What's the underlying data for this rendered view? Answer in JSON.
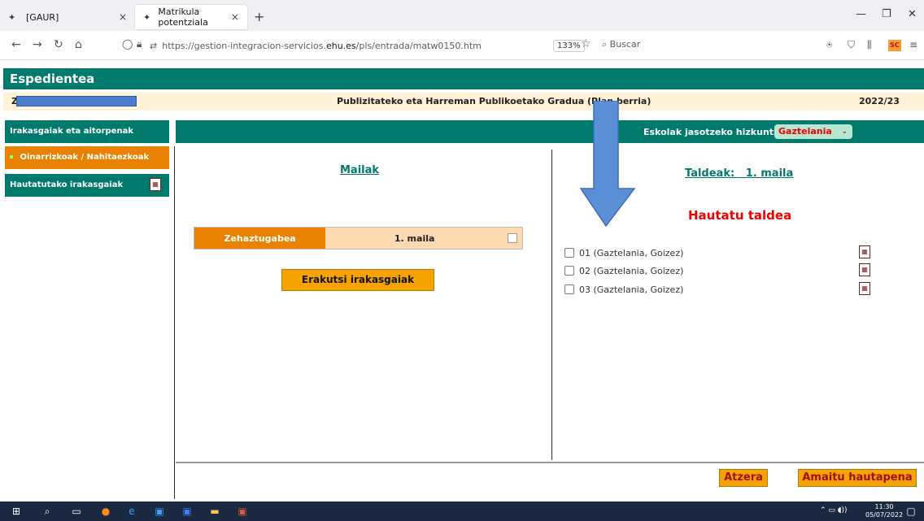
{
  "browser": {
    "tabs": [
      {
        "title": "[GAUR]",
        "close": "×"
      },
      {
        "title": "Matrikula potentziala",
        "close": "×"
      }
    ],
    "new_tab": "+",
    "url_prefix": "https://gestion-integracion-servicios.",
    "url_domain": "ehu.es",
    "url_suffix": "/pls/entrada/matw0150.htm",
    "zoom": "133%",
    "search_placeholder": "Buscar",
    "addon_label": "SC"
  },
  "header": {
    "title": "Espedientea"
  },
  "info": {
    "initial": "Z",
    "plan": "Publizitateko eta Harreman Publikoetako Gradua (Plan berria)",
    "year": "2022/23"
  },
  "sidebar": {
    "items": [
      {
        "label": "Irakasgaiak eta aitorpenak"
      },
      {
        "label": "Oinarrizkoak / Nahitaezkoak"
      },
      {
        "label": "Hautatutako irakasgaiak"
      }
    ]
  },
  "language": {
    "label": "Eskolak jasotzeko hizkuntza:",
    "selected": "Gaztelania"
  },
  "levels": {
    "title": "Mailak",
    "status": "Zehaztugabea",
    "level": "1. maila",
    "show_button": "Erakutsi irakasgaiak"
  },
  "groups": {
    "title": "Taldeak:   1. maila",
    "prompt": "Hautatu taldea",
    "items": [
      {
        "label": "01 (Gaztelania, Goizez)"
      },
      {
        "label": "02 (Gaztelania, Goizez)"
      },
      {
        "label": "03 (Gaztelania, Goizez)"
      }
    ]
  },
  "footer": {
    "back": "Atzera",
    "finish": "Amaitu hautapena"
  },
  "taskbar": {
    "time": "11:30",
    "date": "05/07/2022"
  },
  "colors": {
    "teal": "#007a6c",
    "orange": "#e98200",
    "button_orange": "#f5a300",
    "alert_red": "#e00000",
    "arrow_blue": "#5b8fd6"
  }
}
